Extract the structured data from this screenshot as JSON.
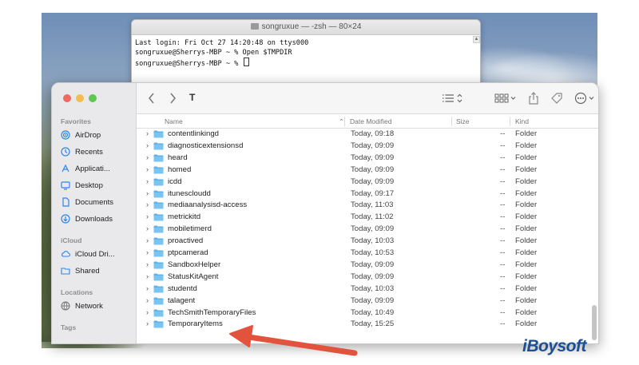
{
  "terminal": {
    "title": "songruxue — -zsh — 80×24",
    "lines": [
      "Last login: Fri Oct 27 14:20:48 on ttys000",
      "songruxue@Sherrys-MBP ~ % Open $TMPDIR",
      "songruxue@Sherrys-MBP ~ % "
    ]
  },
  "finder": {
    "path_title": "T",
    "sidebar": {
      "favorites_label": "Favorites",
      "favorites": [
        {
          "label": "AirDrop",
          "icon": "airdrop-icon"
        },
        {
          "label": "Recents",
          "icon": "recents-icon"
        },
        {
          "label": "Applicati...",
          "icon": "applications-icon"
        },
        {
          "label": "Desktop",
          "icon": "desktop-icon"
        },
        {
          "label": "Documents",
          "icon": "documents-icon"
        },
        {
          "label": "Downloads",
          "icon": "downloads-icon"
        }
      ],
      "icloud_label": "iCloud",
      "icloud": [
        {
          "label": "iCloud Dri...",
          "icon": "icloud-icon"
        },
        {
          "label": "Shared",
          "icon": "shared-folder-icon"
        }
      ],
      "locations_label": "Locations",
      "locations": [
        {
          "label": "Network",
          "icon": "network-icon"
        }
      ],
      "tags_label": "Tags"
    },
    "columns": {
      "name": "Name",
      "date": "Date Modified",
      "size": "Size",
      "kind": "Kind"
    },
    "rows": [
      {
        "name": "contentlinkingd",
        "date": "Today, 09:18",
        "size": "--",
        "kind": "Folder"
      },
      {
        "name": "diagnosticextensionsd",
        "date": "Today, 09:09",
        "size": "--",
        "kind": "Folder"
      },
      {
        "name": "heard",
        "date": "Today, 09:09",
        "size": "--",
        "kind": "Folder"
      },
      {
        "name": "homed",
        "date": "Today, 09:09",
        "size": "--",
        "kind": "Folder"
      },
      {
        "name": "icdd",
        "date": "Today, 09:09",
        "size": "--",
        "kind": "Folder"
      },
      {
        "name": "itunescloudd",
        "date": "Today, 09:17",
        "size": "--",
        "kind": "Folder"
      },
      {
        "name": "mediaanalysisd-access",
        "date": "Today, 11:03",
        "size": "--",
        "kind": "Folder"
      },
      {
        "name": "metrickitd",
        "date": "Today, 11:02",
        "size": "--",
        "kind": "Folder"
      },
      {
        "name": "mobiletimerd",
        "date": "Today, 09:09",
        "size": "--",
        "kind": "Folder"
      },
      {
        "name": "proactived",
        "date": "Today, 10:03",
        "size": "--",
        "kind": "Folder"
      },
      {
        "name": "ptpcamerad",
        "date": "Today, 10:53",
        "size": "--",
        "kind": "Folder"
      },
      {
        "name": "SandboxHelper",
        "date": "Today, 09:09",
        "size": "--",
        "kind": "Folder"
      },
      {
        "name": "StatusKitAgent",
        "date": "Today, 09:09",
        "size": "--",
        "kind": "Folder"
      },
      {
        "name": "studentd",
        "date": "Today, 10:03",
        "size": "--",
        "kind": "Folder"
      },
      {
        "name": "talagent",
        "date": "Today, 09:09",
        "size": "--",
        "kind": "Folder"
      },
      {
        "name": "TechSmithTemporaryFiles",
        "date": "Today, 10:49",
        "size": "--",
        "kind": "Folder"
      },
      {
        "name": "TemporaryItems",
        "date": "Today, 15:25",
        "size": "--",
        "kind": "Folder"
      }
    ]
  },
  "watermark": {
    "text": "iBoysoft"
  },
  "colors": {
    "folder": "#5eb3e8",
    "arrow": "#e2533e",
    "accent": "#1a4f96"
  }
}
